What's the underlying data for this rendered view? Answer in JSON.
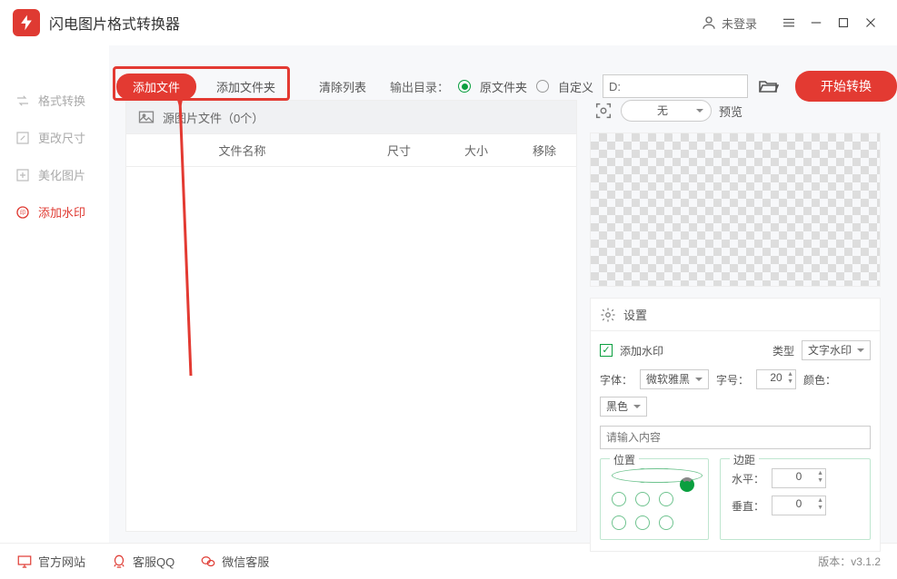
{
  "title": "闪电图片格式转换器",
  "login": "未登录",
  "sidebar": {
    "items": [
      {
        "label": "格式转换"
      },
      {
        "label": "更改尺寸"
      },
      {
        "label": "美化图片"
      },
      {
        "label": "添加水印"
      }
    ]
  },
  "toolbar": {
    "add_file": "添加文件",
    "add_folder": "添加文件夹",
    "clear_list": "清除列表",
    "out_label": "输出目录：",
    "out_src": "原文件夹",
    "out_custom": "自定义",
    "out_path": "D:",
    "start": "开始转换"
  },
  "file_panel": {
    "title": "源图片文件（0个）",
    "cols": {
      "name": "文件名称",
      "size": "尺寸",
      "bytes": "大小",
      "remove": "移除"
    }
  },
  "preview": {
    "select": "无",
    "label": "预览"
  },
  "settings": {
    "title": "设置",
    "add_watermark": "添加水印",
    "type_label": "类型",
    "type_value": "文字水印",
    "font_label": "字体：",
    "font_value": "微软雅黑",
    "size_label": "字号：",
    "size_value": "20",
    "color_label": "颜色：",
    "color_value": "黑色",
    "text_placeholder": "请输入内容",
    "position_legend": "位置",
    "margin_legend": "边距",
    "h_label": "水平：",
    "h_value": "0",
    "v_label": "垂直：",
    "v_value": "0"
  },
  "footer": {
    "site": "官方网站",
    "qq": "客服QQ",
    "wechat": "微信客服",
    "version": "版本：v3.1.2"
  }
}
